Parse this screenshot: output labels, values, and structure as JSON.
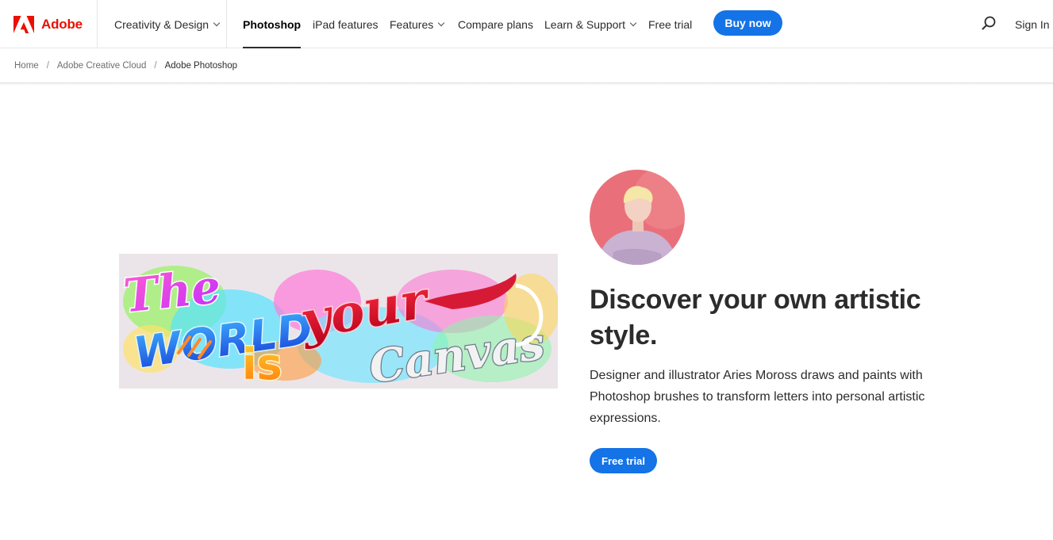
{
  "brand": {
    "name": "Adobe",
    "logo_icon": "adobe-logo-icon",
    "color": "#eb1000"
  },
  "nav": {
    "creativity_label": "Creativity & Design",
    "items": [
      {
        "label": "Photoshop",
        "active": true
      },
      {
        "label": "iPad features"
      },
      {
        "label": "Features",
        "has_dropdown": true
      },
      {
        "label": "Compare plans"
      },
      {
        "label": "Learn & Support",
        "has_dropdown": true
      },
      {
        "label": "Free trial"
      }
    ],
    "buy_label": "Buy now",
    "search_icon": "search-icon",
    "signin_label": "Sign In"
  },
  "breadcrumb": {
    "items": [
      "Home",
      "Adobe Creative Cloud",
      "Adobe Photoshop"
    ],
    "separator": "/"
  },
  "hero": {
    "artwork_text": "The WORLD is your Canvas",
    "headline": "Discover your own artistic style.",
    "body": "Designer and illustrator Aries Moross draws and paints with Photoshop brushes to transform letters into personal artistic expressions.",
    "cta_label": "Free trial"
  },
  "colors": {
    "accent": "#1473e6",
    "text": "#2c2c2c",
    "avatar_bg": "#e9707a"
  }
}
